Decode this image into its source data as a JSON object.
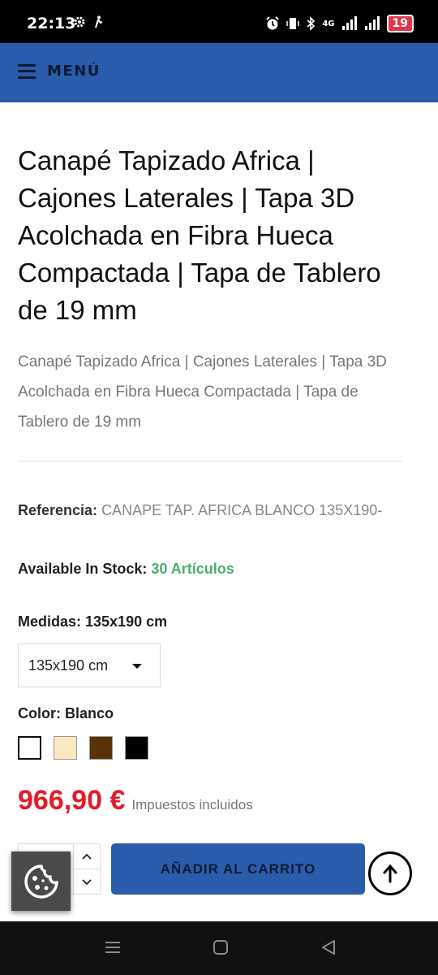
{
  "status_bar": {
    "time": "22:13",
    "network": "4G",
    "battery": "19"
  },
  "navbar": {
    "menu_label": "MENÚ"
  },
  "product": {
    "title": "Canapé Tapizado Africa | Cajones Laterales | Tapa 3D Acolchada en Fibra Hueca Compactada | Tapa de Tablero de 19 mm",
    "description": "Canapé Tapizado Africa | Cajones Laterales | Tapa 3D Acolchada en Fibra Hueca Compactada | Tapa de Tablero de 19 mm",
    "reference_label": "Referencia:",
    "reference_value": "CANAPE TAP. AFRICA BLANCO 135X190-",
    "stock_label": "Available In Stock:",
    "stock_value": "30 Artículos",
    "size_label": "Medidas: 135x190 cm",
    "size_selected": "135x190 cm",
    "color_label": "Color: Blanco",
    "color_swatches": [
      {
        "name": "Blanco",
        "hex": "#ffffff",
        "selected": true
      },
      {
        "name": "Beige",
        "hex": "#fbe7c0",
        "selected": false
      },
      {
        "name": "Marrón",
        "hex": "#5a3207",
        "selected": false
      },
      {
        "name": "Negro",
        "hex": "#000000",
        "selected": false
      }
    ],
    "price": "966,90 €",
    "tax_note": "Impuestos incluidos"
  },
  "actions": {
    "add_to_cart": "AÑADIR AL CARRITO"
  },
  "colors": {
    "brand_blue": "#2b5bab",
    "price_red": "#e31b2a",
    "stock_green": "#4cae6a"
  },
  "icons": {
    "menu": "hamburger-icon",
    "scroll_top": "arrow-up-icon",
    "cookie": "cookie-icon",
    "qty_up": "chevron-up-icon",
    "qty_down": "chevron-down-icon"
  }
}
